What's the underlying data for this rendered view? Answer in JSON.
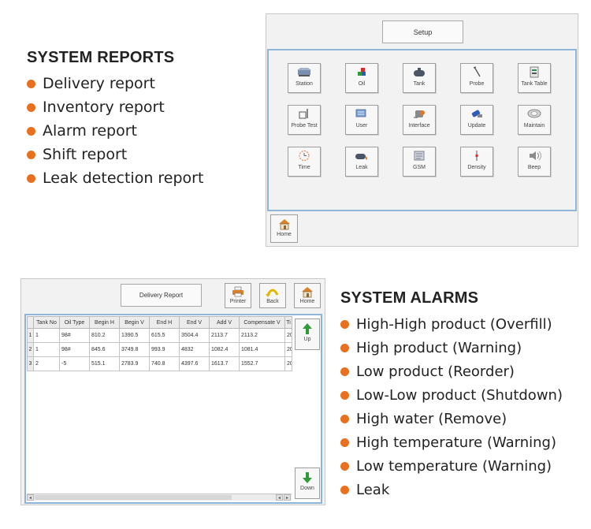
{
  "system_reports": {
    "title": "SYSTEM REPORTS",
    "items": [
      "Delivery report",
      "Inventory report",
      "Alarm report",
      "Shift report",
      "Leak detection report"
    ]
  },
  "setup_screen": {
    "title": "Setup",
    "tiles": [
      {
        "label": "Station",
        "icon": "station-icon"
      },
      {
        "label": "Oil",
        "icon": "oil-icon"
      },
      {
        "label": "Tank",
        "icon": "tank-icon"
      },
      {
        "label": "Probe",
        "icon": "probe-icon"
      },
      {
        "label": "Tank Table",
        "icon": "tank-table-icon"
      },
      {
        "label": "Probe Test",
        "icon": "probe-test-icon"
      },
      {
        "label": "User",
        "icon": "user-icon"
      },
      {
        "label": "Interface",
        "icon": "interface-icon"
      },
      {
        "label": "Update",
        "icon": "update-icon"
      },
      {
        "label": "Maintain",
        "icon": "maintain-icon"
      },
      {
        "label": "Time",
        "icon": "time-icon"
      },
      {
        "label": "Leak",
        "icon": "leak-icon"
      },
      {
        "label": "GSM",
        "icon": "gsm-icon"
      },
      {
        "label": "Density",
        "icon": "density-icon"
      },
      {
        "label": "Beep",
        "icon": "beep-icon"
      }
    ],
    "home_label": "Home"
  },
  "report_screen": {
    "title": "Delivery Report",
    "printer_label": "Printer",
    "back_label": "Back",
    "home_label": "Home",
    "up_label": "Up",
    "down_label": "Down",
    "columns": [
      "Tank No",
      "Oil Type",
      "Begin H",
      "Begin V",
      "End H",
      "End V",
      "Add V",
      "Compensate V",
      "Ti"
    ],
    "rows": [
      {
        "n": "1",
        "cells": [
          "1",
          "98#",
          "810.2",
          "1390.5",
          "615.5",
          "3504.4",
          "2113.7",
          "2113.2",
          "20"
        ]
      },
      {
        "n": "2",
        "cells": [
          "1",
          "98#",
          "845.6",
          "3749.8",
          "993.9",
          "4832",
          "1082.4",
          "1081.4",
          "20"
        ]
      },
      {
        "n": "3",
        "cells": [
          "2",
          "-5",
          "515.1",
          "2783.9",
          "740.8",
          "4397.6",
          "1613.7",
          "1552.7",
          "20"
        ]
      }
    ]
  },
  "system_alarms": {
    "title": "SYSTEM ALARMS",
    "items": [
      "High-High product (Overfill)",
      "High product (Warning)",
      "Low product (Reorder)",
      "Low-Low product (Shutdown)",
      "High water (Remove)",
      "High temperature (Warning)",
      "Low temperature (Warning)",
      "Leak"
    ]
  },
  "colors": {
    "bullet": "#e8701e",
    "panel_border": "#8eb4d8"
  }
}
